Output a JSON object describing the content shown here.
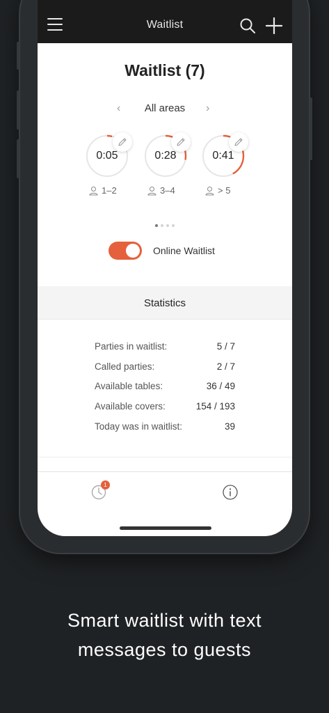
{
  "nav": {
    "menu_icon": "hamburger-menu-icon",
    "title": "Waitlist",
    "search_icon": "search-icon",
    "add_icon": "plus-icon"
  },
  "heading": "Waitlist (7)",
  "area_selector": {
    "label": "All areas",
    "prev_icon": "chevron-left-icon",
    "next_icon": "chevron-right-icon"
  },
  "timers": [
    {
      "time": "0:05",
      "party": "1–2",
      "progress": 0.04
    },
    {
      "time": "0:28",
      "party": "3–4",
      "progress": 0.28
    },
    {
      "time": "0:41",
      "party": "> 5",
      "progress": 0.42
    }
  ],
  "pager": {
    "count": 4,
    "active": 0
  },
  "toggle": {
    "label": "Online Waitlist",
    "on": true
  },
  "statistics": {
    "title": "Statistics",
    "rows": [
      {
        "label": "Parties in waitlist:",
        "value": "5 / 7"
      },
      {
        "label": "Called parties:",
        "value": "2 / 7"
      },
      {
        "label": "Available tables:",
        "value": "36 / 49"
      },
      {
        "label": "Available covers:",
        "value": "154 / 193"
      },
      {
        "label": "Today was in waitlist:",
        "value": "39"
      }
    ]
  },
  "tabbar": {
    "clock_icon": "clock-icon",
    "clock_badge": "1",
    "info_icon": "info-icon"
  },
  "caption": {
    "line1": "Smart waitlist with text",
    "line2": "messages to guests"
  },
  "colors": {
    "accent": "#e5603c",
    "navbar": "#1b1b1b",
    "background": "#1f2224"
  }
}
